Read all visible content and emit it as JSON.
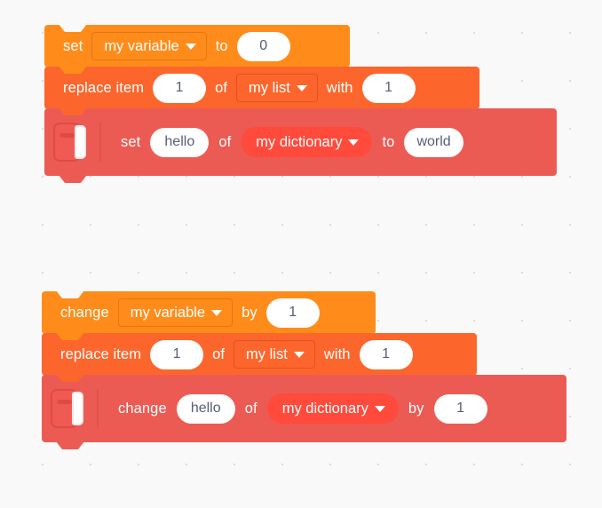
{
  "canvas": {
    "background_color": "#f9f9f9",
    "dot_color": "#d9d9d9"
  },
  "palette": {
    "variable_color": "#FF8C1A",
    "list_color": "#FC662C",
    "dictionary_color": "#EC5B53",
    "dictionary_field_color": "#FF4A3C",
    "input_text_color": "#575E75",
    "label_text_color": "#FFFFFF"
  },
  "stacks": [
    {
      "name": "set-stack",
      "blocks": [
        {
          "id": "set-variable-block",
          "category": "variables",
          "label_1": "set",
          "dropdown_value": "my variable",
          "label_2": "to",
          "input_value": "0"
        },
        {
          "id": "replace-item-block",
          "category": "list",
          "label_1": "replace item",
          "index_value": "1",
          "label_2": "of",
          "dropdown_value": "my list",
          "label_3": "with",
          "value": "1"
        },
        {
          "id": "set-dictionary-block",
          "category": "dictionary",
          "icon": "dictionary-book-icon",
          "label_1": "set",
          "key_value": "hello",
          "label_2": "of",
          "dropdown_value": "my dictionary",
          "label_3": "to",
          "value": "world"
        }
      ]
    },
    {
      "name": "change-stack",
      "blocks": [
        {
          "id": "change-variable-block",
          "category": "variables",
          "label_1": "change",
          "dropdown_value": "my variable",
          "label_2": "by",
          "input_value": "1"
        },
        {
          "id": "replace-item-block-2",
          "category": "list",
          "label_1": "replace item",
          "index_value": "1",
          "label_2": "of",
          "dropdown_value": "my list",
          "label_3": "with",
          "value": "1"
        },
        {
          "id": "change-dictionary-block",
          "category": "dictionary",
          "icon": "dictionary-book-icon",
          "label_1": "change",
          "key_value": "hello",
          "label_2": "of",
          "dropdown_value": "my dictionary",
          "label_3": "by",
          "value": "1"
        }
      ]
    }
  ]
}
